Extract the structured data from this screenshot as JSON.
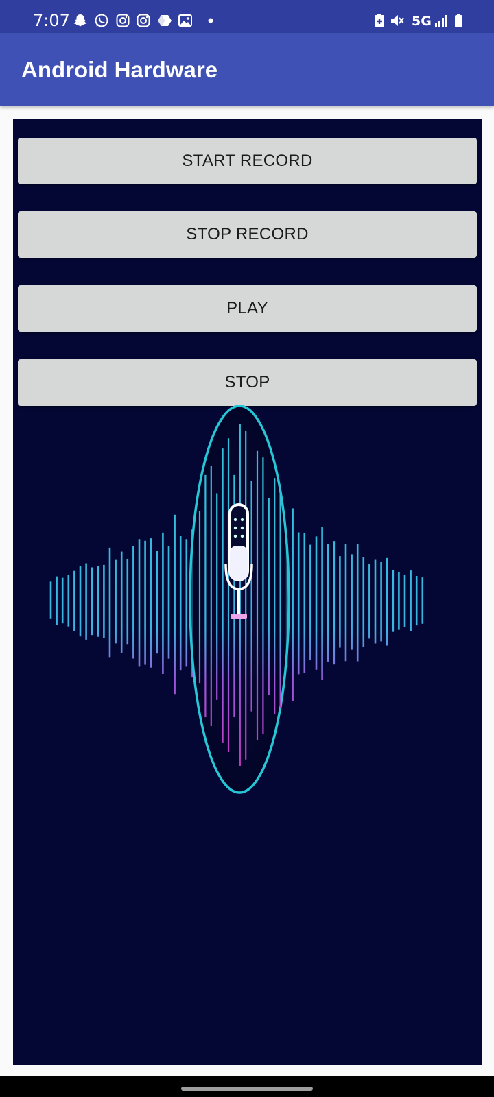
{
  "status_bar": {
    "time": "7:07",
    "network": "5G",
    "notification_icons": [
      "snapchat-icon",
      "whatsapp-icon",
      "instagram-icon",
      "instagram-icon",
      "drive-icon",
      "gallery-icon",
      "dot-icon"
    ],
    "system_icons": [
      "battery-saver-icon",
      "mute-icon",
      "signal-icon",
      "battery-icon"
    ]
  },
  "app_bar": {
    "title": "Android Hardware",
    "color": "#3f51b5"
  },
  "buttons": {
    "start_record": "START RECORD",
    "stop_record": "STOP RECORD",
    "play": "PLAY",
    "stop": "STOP"
  },
  "visual": {
    "icon": "microphone-icon",
    "style": "sound-wave"
  },
  "colors": {
    "status_bar": "#303f9f",
    "content_background": "#040733",
    "button_background": "#d6d7d7",
    "wave_teal": "#2ec4d6",
    "wave_magenta": "#d62ab4"
  }
}
